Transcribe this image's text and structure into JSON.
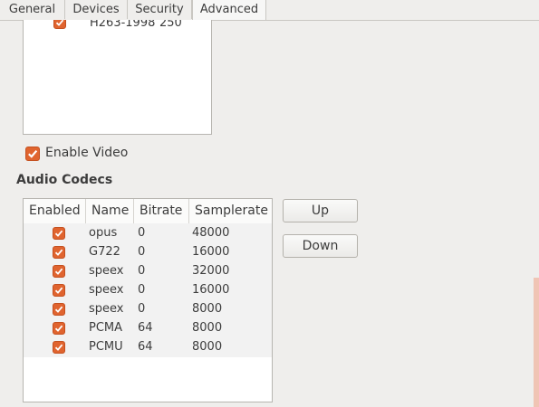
{
  "tabs": [
    {
      "label": "General",
      "active": false
    },
    {
      "label": "Devices",
      "active": false
    },
    {
      "label": "Security",
      "active": false
    },
    {
      "label": "Advanced",
      "active": true
    }
  ],
  "video_codecs": {
    "partial_row": {
      "name": "H263-1998",
      "bitrate": "250",
      "enabled": true
    }
  },
  "enable_video": {
    "label": "Enable Video",
    "checked": true
  },
  "audio_section": {
    "title": "Audio Codecs"
  },
  "audio_table": {
    "columns": [
      "Enabled",
      "Name",
      "Bitrate",
      "Samplerate"
    ],
    "rows": [
      {
        "enabled": true,
        "name": "opus",
        "bitrate": "0",
        "samplerate": "48000"
      },
      {
        "enabled": true,
        "name": "G722",
        "bitrate": "0",
        "samplerate": "16000"
      },
      {
        "enabled": true,
        "name": "speex",
        "bitrate": "0",
        "samplerate": "32000"
      },
      {
        "enabled": true,
        "name": "speex",
        "bitrate": "0",
        "samplerate": "16000"
      },
      {
        "enabled": true,
        "name": "speex",
        "bitrate": "0",
        "samplerate": "8000"
      },
      {
        "enabled": true,
        "name": "PCMA",
        "bitrate": "64",
        "samplerate": "8000"
      },
      {
        "enabled": true,
        "name": "PCMU",
        "bitrate": "64",
        "samplerate": "8000"
      }
    ]
  },
  "buttons": {
    "up": "Up",
    "down": "Down"
  },
  "colors": {
    "accent": "#e0642f",
    "check": "#ffffff"
  },
  "icons": {
    "checkbox": "checkmark-icon"
  }
}
